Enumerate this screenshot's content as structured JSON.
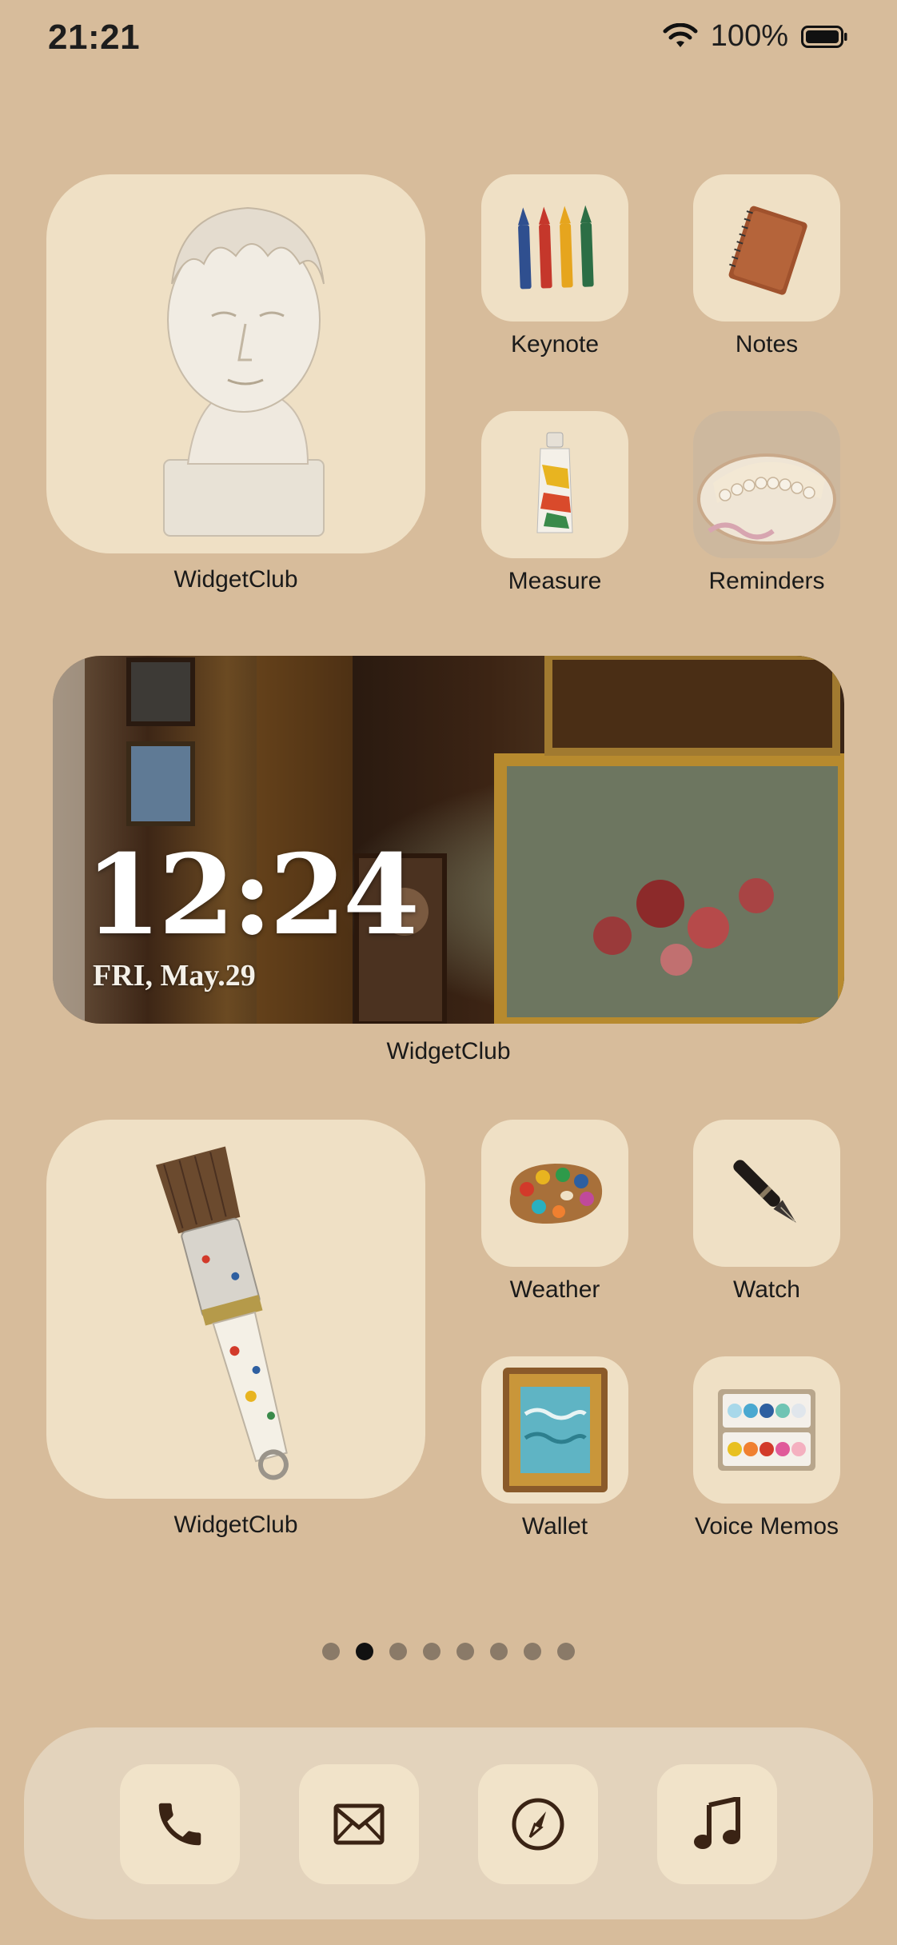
{
  "status_bar": {
    "time": "21:21",
    "battery_percent": "100%"
  },
  "widgets": {
    "top_left_label": "WidgetClub",
    "clock": {
      "time": "12:24",
      "date": "FRI, May.29",
      "label": "WidgetClub"
    },
    "bottom_left_label": "WidgetClub"
  },
  "apps": [
    {
      "label": "Keynote",
      "icon": "crayons-icon"
    },
    {
      "label": "Notes",
      "icon": "notebook-icon"
    },
    {
      "label": "Measure",
      "icon": "paint-tube-icon"
    },
    {
      "label": "Reminders",
      "icon": "pearls-cake-icon"
    },
    {
      "label": "Weather",
      "icon": "palette-icon"
    },
    {
      "label": "Watch",
      "icon": "fountain-pen-icon"
    },
    {
      "label": "Wallet",
      "icon": "framed-painting-icon"
    },
    {
      "label": "Voice Memos",
      "icon": "watercolor-set-icon"
    }
  ],
  "page_dots": {
    "count": 8,
    "active_index": 1
  },
  "dock": [
    {
      "icon": "phone-icon"
    },
    {
      "icon": "mail-icon"
    },
    {
      "icon": "compass-icon"
    },
    {
      "icon": "music-icon"
    }
  ],
  "colors": {
    "background": "#d7bc9b",
    "tile": "#efe0c5",
    "dock": "#e3d3bc",
    "icon_dark": "#3a2314"
  }
}
